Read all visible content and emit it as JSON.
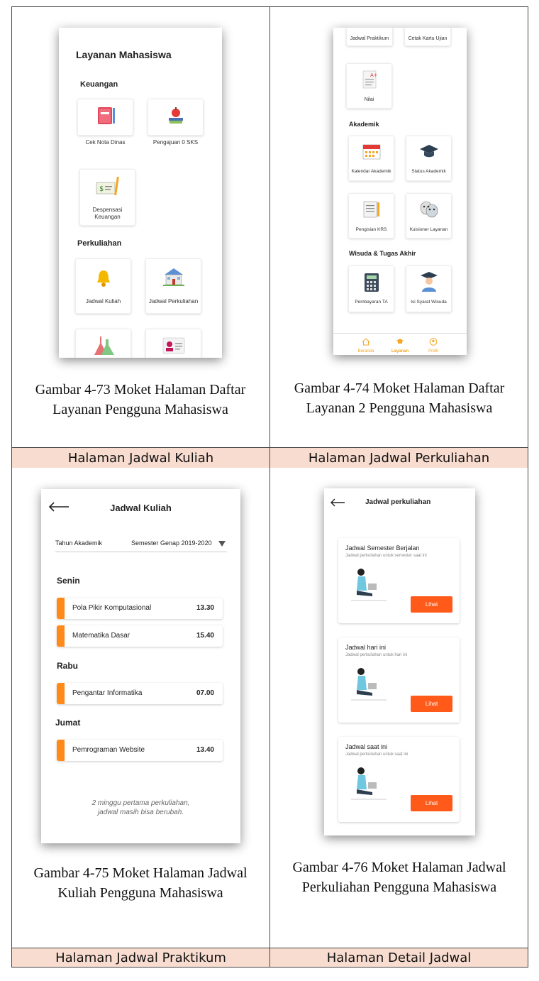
{
  "cells": {
    "top_left": {
      "phone_title": "Layanan Mahasiswa",
      "sections": [
        {
          "title": "Keuangan",
          "items": [
            {
              "label": "Cek Nota Dinas",
              "icon": "notebook-icon"
            },
            {
              "label": "Pengajuan 0 SKS",
              "icon": "apple-books-icon"
            },
            {
              "label": "Despensasi Keuangan",
              "icon": "cheque-icon"
            }
          ]
        },
        {
          "title": "Perkuliahan",
          "items": [
            {
              "label": "Jadwal Kuliah",
              "icon": "bell-icon"
            },
            {
              "label": "Jadwal Perkuliahan",
              "icon": "school-icon"
            },
            {
              "label": "",
              "icon": "flask-icon"
            },
            {
              "label": "",
              "icon": "id-card-icon"
            }
          ]
        }
      ],
      "caption": "Gambar 4-73 Moket Halaman Daftar Layanan Pengguna Mahasiswa"
    },
    "top_right": {
      "top_items": [
        {
          "label": "Jadwal Praktikum"
        },
        {
          "label": "Cetak Kartu Ujian"
        }
      ],
      "nilai": "Nilai",
      "sections": [
        {
          "title": "Akademik",
          "items": [
            {
              "label": "Kalendar Akademik",
              "icon": "calendar-icon"
            },
            {
              "label": "Status Akademik",
              "icon": "graduation-cap-icon"
            },
            {
              "label": "Pengisian KRS",
              "icon": "document-pencil-icon"
            },
            {
              "label": "Kuisioner Layanan",
              "icon": "masks-icon"
            }
          ]
        },
        {
          "title": "Wisuda & Tugas Akhir",
          "items": [
            {
              "label": "Pembayaran TA",
              "icon": "calculator-icon"
            },
            {
              "label": "Isi Syarat Wisuda",
              "icon": "graduate-icon"
            }
          ]
        }
      ],
      "nav": [
        {
          "label": "Beranda",
          "icon": "home-icon"
        },
        {
          "label": "Layanan",
          "icon": "cap-icon"
        },
        {
          "label": "Profil",
          "icon": "user-icon"
        }
      ],
      "caption": "Gambar 4-74 Moket Halaman Daftar Layanan 2 Pengguna Mahasiswa"
    },
    "bottom_left": {
      "title": "Jadwal Kuliah",
      "select_label": "Tahun Akademik",
      "select_value": "Semester Genap 2019-2020",
      "days": [
        {
          "day": "Senin",
          "items": [
            {
              "name": "Pola Pikir Komputasional",
              "time": "13.30"
            },
            {
              "name": "Matematika Dasar",
              "time": "15.40"
            }
          ]
        },
        {
          "day": "Rabu",
          "items": [
            {
              "name": "Pengantar Informatika",
              "time": "07.00"
            }
          ]
        },
        {
          "day": "Jumat",
          "items": [
            {
              "name": "Pemrograman Website",
              "time": "13.40"
            }
          ]
        }
      ],
      "note_line1": "2 minggu pertama perkuliahan,",
      "note_line2": "jadwal masih bisa berubah.",
      "caption": "Gambar 4-75 Moket Halaman Jadwal Kuliah Pengguna Mahasiswa"
    },
    "bottom_right": {
      "title": "Jadwal perkuliahan",
      "cards": [
        {
          "title": "Jadwal Semester Berjalan",
          "subtitle": "Jadwal perkuliahan untuk semester saat ini",
          "button": "Lihat"
        },
        {
          "title": "Jadwal hari ini",
          "subtitle": "Jadwal perkuliahan untuk hari ini",
          "button": "Lihat"
        },
        {
          "title": "Jadwal saat ini",
          "subtitle": "Jadwal perkuliahan untuk saat ini",
          "button": "Lihat"
        }
      ],
      "caption": "Gambar 4-76 Moket Halaman Jadwal Perkuliahan Pengguna Mahasiswa"
    }
  },
  "headers": {
    "row2_left": "Halaman Jadwal Kuliah",
    "row2_right": "Halaman Jadwal Perkuliahan",
    "row3_left": "Halaman Jadwal Praktikum",
    "row3_right": "Halaman Detail Jadwal"
  },
  "colors": {
    "accent": "#ff8a1a",
    "button": "#ff5a1a",
    "header_bg": "#f8dccf"
  }
}
